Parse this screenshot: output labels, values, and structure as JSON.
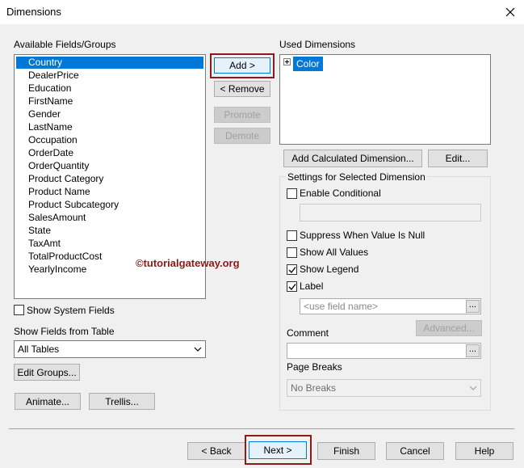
{
  "window": {
    "title": "Dimensions"
  },
  "available": {
    "label": "Available Fields/Groups",
    "items": [
      "Country",
      "DealerPrice",
      "Education",
      "FirstName",
      "Gender",
      "LastName",
      "Occupation",
      "OrderDate",
      "OrderQuantity",
      "Product Category",
      "Product Name",
      "Product Subcategory",
      "SalesAmount",
      "State",
      "TaxAmt",
      "TotalProductCost",
      "YearlyIncome"
    ],
    "selected_index": 0
  },
  "buttons": {
    "add": "Add >",
    "remove": "< Remove",
    "promote": "Promote",
    "demote": "Demote",
    "add_calculated": "Add Calculated Dimension...",
    "edit": "Edit...",
    "advanced": "Advanced...",
    "edit_groups": "Edit Groups...",
    "animate": "Animate...",
    "trellis": "Trellis...",
    "back": "< Back",
    "next": "Next >",
    "finish": "Finish",
    "cancel": "Cancel",
    "help": "Help"
  },
  "used": {
    "label": "Used Dimensions",
    "items": [
      "Color"
    ]
  },
  "settings": {
    "legend": "Settings for Selected Dimension",
    "enable_conditional": {
      "label": "Enable Conditional",
      "checked": false
    },
    "suppress_null": {
      "label": "Suppress When Value Is Null",
      "checked": false
    },
    "show_all_values": {
      "label": "Show All Values",
      "checked": false
    },
    "show_legend": {
      "label": "Show Legend",
      "checked": true
    },
    "label_cb": {
      "label": "Label",
      "checked": true
    },
    "label_field_placeholder": "<use field name>",
    "comment_label": "Comment",
    "page_breaks_label": "Page Breaks",
    "page_breaks_value": "No Breaks"
  },
  "left_bottom": {
    "show_system_fields": {
      "label": "Show System Fields",
      "checked": false
    },
    "show_fields_from_table_label": "Show Fields from Table",
    "table_value": "All Tables"
  },
  "watermark": "©tutorialgateway.org",
  "colors": {
    "selection": "#0078d7",
    "highlight": "#8b1a1a",
    "watermark": "#8b1a1a"
  }
}
